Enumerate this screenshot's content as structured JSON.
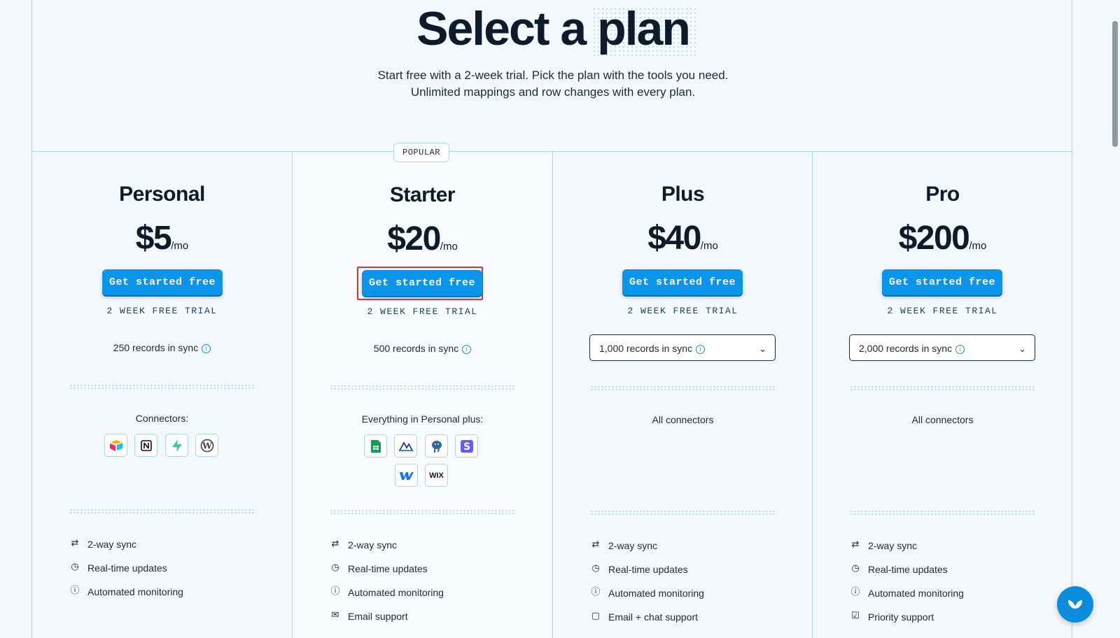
{
  "header": {
    "title_part1": "Select a",
    "title_part2": "plan",
    "subtitle_line1": "Start free with a 2-week trial. Pick the plan with the tools you need.",
    "subtitle_line2": "Unlimited mappings and row changes with every plan."
  },
  "popular_badge": "POPULAR",
  "plans": [
    {
      "name": "Personal",
      "price": "$5",
      "per": "/mo",
      "cta": "Get started free",
      "trial": "2 WEEK FREE TRIAL",
      "records": "250 records in sync",
      "connectors_label": "Connectors:",
      "connectors": [
        "airtable-icon",
        "notion-icon",
        "supabase-icon",
        "wordpress-icon"
      ],
      "features": [
        {
          "icon": "arrows-swap-icon",
          "label": "2-way sync"
        },
        {
          "icon": "clock-icon",
          "label": "Real-time updates"
        },
        {
          "icon": "alert-circle-icon",
          "label": "Automated monitoring"
        }
      ]
    },
    {
      "name": "Starter",
      "price": "$20",
      "per": "/mo",
      "cta": "Get started free",
      "trial": "2 WEEK FREE TRIAL",
      "records": "500 records in sync",
      "connectors_label": "Everything in Personal plus:",
      "connectors": [
        "google-sheets-icon",
        "metabase-icon",
        "postgres-icon",
        "stripe-icon",
        "webflow-icon",
        "wix-icon"
      ],
      "wix_text": "WIX",
      "features": [
        {
          "icon": "arrows-swap-icon",
          "label": "2-way sync"
        },
        {
          "icon": "clock-icon",
          "label": "Real-time updates"
        },
        {
          "icon": "alert-circle-icon",
          "label": "Automated monitoring"
        },
        {
          "icon": "mail-icon",
          "label": "Email support"
        }
      ]
    },
    {
      "name": "Plus",
      "price": "$40",
      "per": "/mo",
      "cta": "Get started free",
      "trial": "2 WEEK FREE TRIAL",
      "records": "1,000 records in sync",
      "connectors_label": "All connectors",
      "features": [
        {
          "icon": "arrows-swap-icon",
          "label": "2-way sync"
        },
        {
          "icon": "clock-icon",
          "label": "Real-time updates"
        },
        {
          "icon": "alert-circle-icon",
          "label": "Automated monitoring"
        },
        {
          "icon": "chat-icon",
          "label": "Email + chat support"
        }
      ]
    },
    {
      "name": "Pro",
      "price": "$200",
      "per": "/mo",
      "cta": "Get started free",
      "trial": "2 WEEK FREE TRIAL",
      "records": "2,000 records in sync",
      "connectors_label": "All connectors",
      "features": [
        {
          "icon": "arrows-swap-icon",
          "label": "2-way sync"
        },
        {
          "icon": "clock-icon",
          "label": "Real-time updates"
        },
        {
          "icon": "alert-circle-icon",
          "label": "Automated monitoring"
        },
        {
          "icon": "chat-check-icon",
          "label": "Priority support"
        }
      ]
    }
  ],
  "colors": {
    "accent": "#0a95ea",
    "highlight": "#e03131",
    "grid_line": "#a9d6ee"
  },
  "chat_widget_icon": "chat-widget-icon"
}
